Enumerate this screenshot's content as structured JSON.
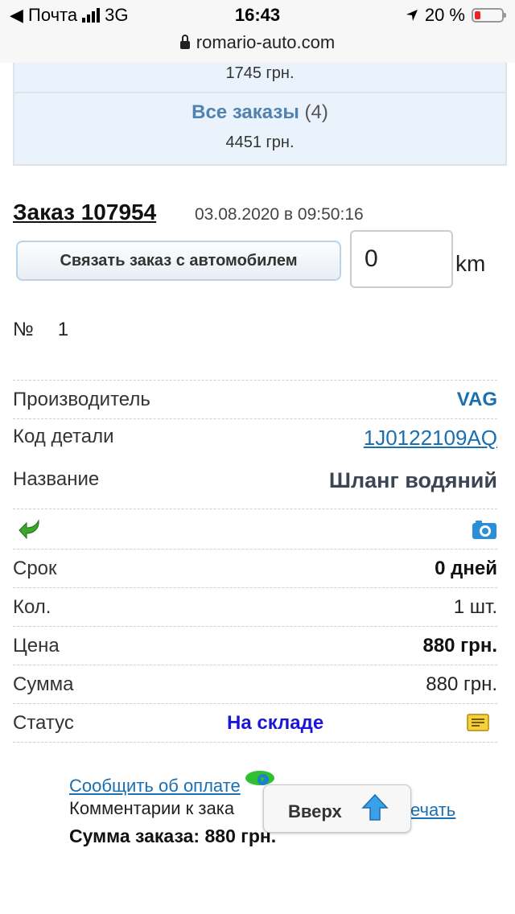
{
  "status_bar": {
    "carrier": "◀ Почта",
    "network": "3G",
    "time": "16:43",
    "battery": "20 %"
  },
  "browser": {
    "url": "romario-auto.com"
  },
  "summary": {
    "prev_amount": "1745 грн.",
    "all_orders_label": "Все заказы",
    "all_orders_count": "(4)",
    "all_orders_amount": "4451 грн."
  },
  "order": {
    "title": "Заказ 107954",
    "date": "03.08.2020 в 09:50:16",
    "link_car_button": "Связать заказ с автомобилем",
    "km_value": "0",
    "km_unit": "km",
    "number_label": "№",
    "number_value": "1"
  },
  "details": {
    "manufacturer_label": "Производитель",
    "manufacturer_value": "VAG",
    "part_code_label": "Код детали",
    "part_code_value": "1J0122109AQ",
    "name_label": "Название",
    "name_value": "Шланг водяний",
    "term_label": "Срок",
    "term_value": "0 дней",
    "qty_label": "Кол.",
    "qty_value": "1 шт.",
    "price_label": "Цена",
    "price_value": "880 грн.",
    "sum_label": "Сумма",
    "sum_value": "880 грн.",
    "status_label": "Статус",
    "status_value": "На складе"
  },
  "footer": {
    "report_payment": "Сообщить об оплате",
    "comments_label": "Комментарии к зака",
    "print_label": "ечать",
    "order_total": "Сумма заказа: 880 грн.",
    "up_button": "Вверх"
  },
  "colors": {
    "link": "#1a6fb0",
    "status": "#1c17d6",
    "summary_bg": "#eaf2fb"
  }
}
